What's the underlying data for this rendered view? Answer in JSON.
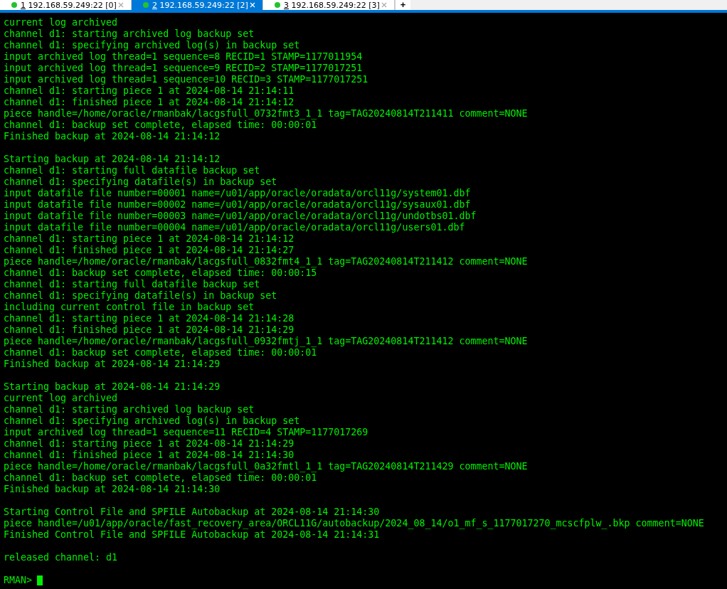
{
  "tabs": [
    {
      "number": "1",
      "host": "192.168.59.249:22 [0]",
      "selected": false,
      "connected": true
    },
    {
      "number": "2",
      "host": "192.168.59.249:22 [2]",
      "selected": true,
      "connected": true
    },
    {
      "number": "3",
      "host": "192.168.59.249:22 [3]",
      "selected": false,
      "connected": true
    }
  ],
  "new_tab": "+",
  "terminal": {
    "blocks": [
      [
        "current log archived",
        "channel d1: starting archived log backup set",
        "channel d1: specifying archived log(s) in backup set",
        "input archived log thread=1 sequence=8 RECID=1 STAMP=1177011954",
        "input archived log thread=1 sequence=9 RECID=2 STAMP=1177017251",
        "input archived log thread=1 sequence=10 RECID=3 STAMP=1177017251",
        "channel d1: starting piece 1 at 2024-08-14 21:14:11",
        "channel d1: finished piece 1 at 2024-08-14 21:14:12",
        "piece handle=/home/oracle/rmanbak/lacgsfull_0732fmt3_1_1 tag=TAG20240814T211411 comment=NONE",
        "channel d1: backup set complete, elapsed time: 00:00:01",
        "Finished backup at 2024-08-14 21:14:12"
      ],
      [
        "Starting backup at 2024-08-14 21:14:12",
        "channel d1: starting full datafile backup set",
        "channel d1: specifying datafile(s) in backup set",
        "input datafile file number=00001 name=/u01/app/oracle/oradata/orcl11g/system01.dbf",
        "input datafile file number=00002 name=/u01/app/oracle/oradata/orcl11g/sysaux01.dbf",
        "input datafile file number=00003 name=/u01/app/oracle/oradata/orcl11g/undotbs01.dbf",
        "input datafile file number=00004 name=/u01/app/oracle/oradata/orcl11g/users01.dbf",
        "channel d1: starting piece 1 at 2024-08-14 21:14:12",
        "channel d1: finished piece 1 at 2024-08-14 21:14:27",
        "piece handle=/home/oracle/rmanbak/lacgsfull_0832fmt4_1_1 tag=TAG20240814T211412 comment=NONE",
        "channel d1: backup set complete, elapsed time: 00:00:15",
        "channel d1: starting full datafile backup set",
        "channel d1: specifying datafile(s) in backup set",
        "including current control file in backup set",
        "channel d1: starting piece 1 at 2024-08-14 21:14:28",
        "channel d1: finished piece 1 at 2024-08-14 21:14:29",
        "piece handle=/home/oracle/rmanbak/lacgsfull_0932fmtj_1_1 tag=TAG20240814T211412 comment=NONE",
        "channel d1: backup set complete, elapsed time: 00:00:01",
        "Finished backup at 2024-08-14 21:14:29"
      ],
      [
        "Starting backup at 2024-08-14 21:14:29",
        "current log archived",
        "channel d1: starting archived log backup set",
        "channel d1: specifying archived log(s) in backup set",
        "input archived log thread=1 sequence=11 RECID=4 STAMP=1177017269",
        "channel d1: starting piece 1 at 2024-08-14 21:14:29",
        "channel d1: finished piece 1 at 2024-08-14 21:14:30",
        "piece handle=/home/oracle/rmanbak/lacgsfull_0a32fmtl_1_1 tag=TAG20240814T211429 comment=NONE",
        "channel d1: backup set complete, elapsed time: 00:00:01",
        "Finished backup at 2024-08-14 21:14:30"
      ],
      [
        "Starting Control File and SPFILE Autobackup at 2024-08-14 21:14:30",
        "piece handle=/u01/app/oracle/fast_recovery_area/ORCL11G/autobackup/2024_08_14/o1_mf_s_1177017270_mcscfplw_.bkp comment=NONE",
        "Finished Control File and SPFILE Autobackup at 2024-08-14 21:14:31"
      ],
      [
        "released channel: d1"
      ]
    ],
    "prompt": "RMAN>"
  }
}
